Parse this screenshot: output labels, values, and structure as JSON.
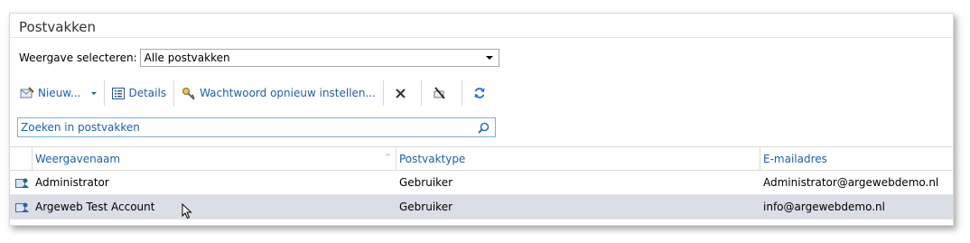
{
  "panel": {
    "title": "Postvakken"
  },
  "view": {
    "label": "Weergave selecteren:",
    "selected": "Alle postvakken"
  },
  "toolbar": {
    "new_label": "Nieuw...",
    "details_label": "Details",
    "reset_password_label": "Wachtwoord opnieuw instellen...",
    "icons": [
      "new-mailbox-icon",
      "details-icon",
      "key-icon",
      "delete-icon",
      "disable-icon",
      "refresh-icon"
    ]
  },
  "search": {
    "placeholder": "Zoeken in postvakken"
  },
  "grid": {
    "columns": [
      "Weergavenaam",
      "Postvaktype",
      "E-mailadres"
    ],
    "rows": [
      {
        "name": "Administrator",
        "type": "Gebruiker",
        "email": "Administrator@argewebdemo.nl",
        "selected": false
      },
      {
        "name": "Argeweb Test Account",
        "type": "Gebruiker",
        "email": "info@argewebdemo.nl",
        "selected": true
      }
    ]
  },
  "colors": {
    "link": "#1f5fa8",
    "selected_row": "#dadee5",
    "search_border": "#7fb1d8"
  }
}
